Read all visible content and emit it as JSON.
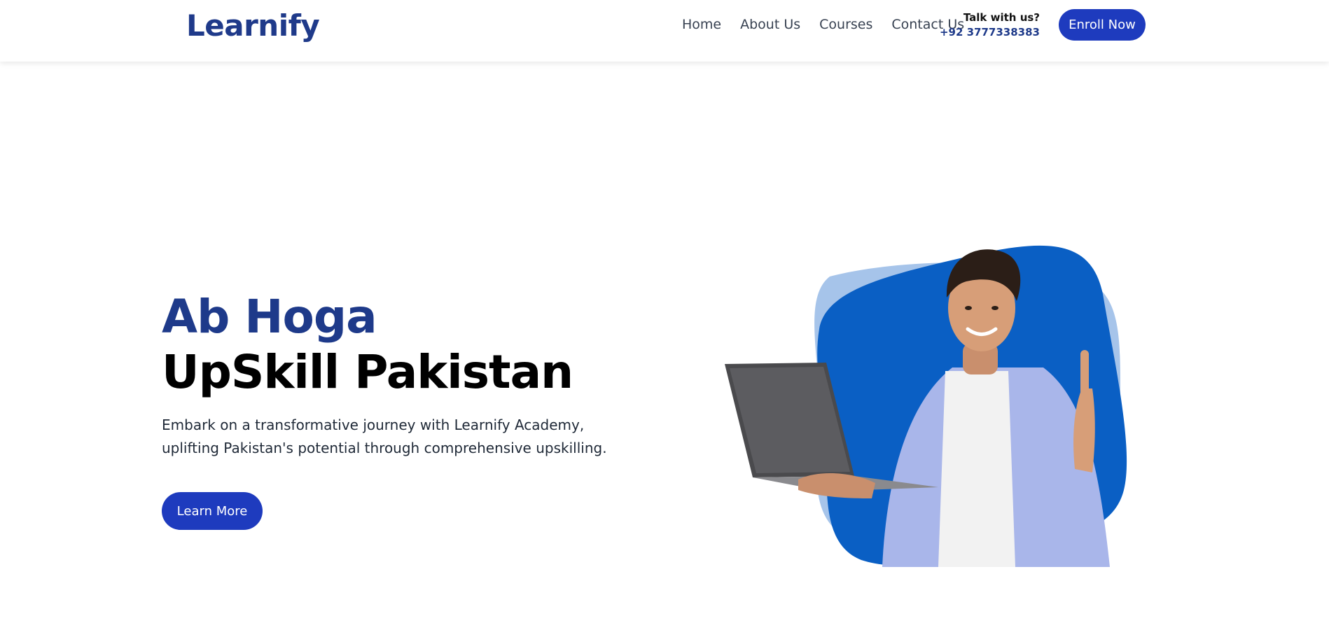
{
  "header": {
    "logo": "Learnify",
    "nav": [
      {
        "label": "Home"
      },
      {
        "label": "About Us"
      },
      {
        "label": "Courses"
      },
      {
        "label": "Contact Us"
      }
    ],
    "contact_label": "Talk with us?",
    "contact_phone": "+92 3777338383",
    "enroll_label": "Enroll Now"
  },
  "hero": {
    "headline_line1": "Ab Hoga",
    "headline_line2": "UpSkill Pakistan",
    "description": "Embark on a transformative journey with Learnify Academy, uplifting Pakistan's potential through comprehensive upskilling.",
    "cta_label": "Learn More"
  },
  "colors": {
    "brand_blue": "#1e3a8a",
    "button_blue": "#1e3bbe",
    "blob_dark": "#0a5fc4",
    "blob_light": "#a6c4ea"
  },
  "icons": {
    "hero_image": "man-with-laptop-illustration"
  }
}
